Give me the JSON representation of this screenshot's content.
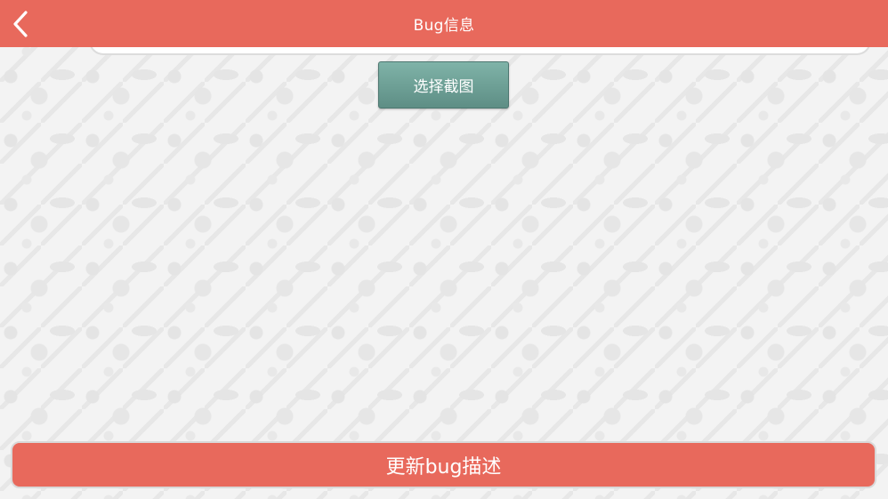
{
  "header": {
    "title": "Bug信息",
    "back_icon": "chevron-left-icon"
  },
  "form": {
    "select_screenshot_label": "选择截图"
  },
  "footer": {
    "update_label": "更新bug描述"
  },
  "colors": {
    "accent": "#e8695c",
    "button_teal": "#6b9b92",
    "background": "#f3f3f3"
  }
}
